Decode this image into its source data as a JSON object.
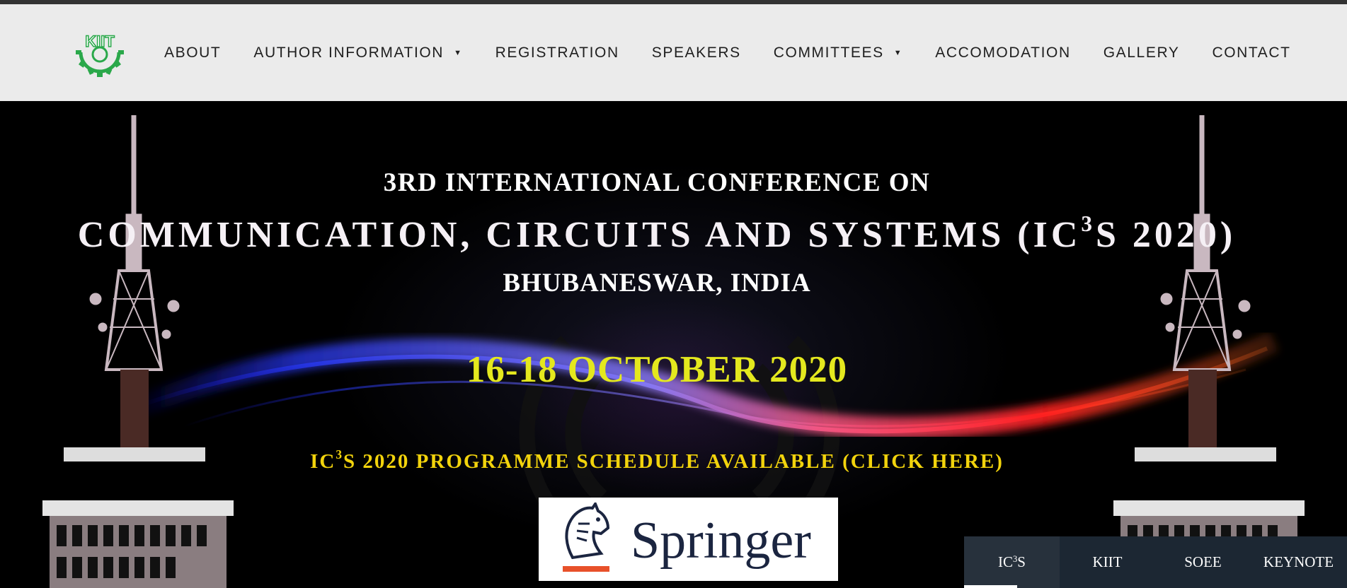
{
  "nav": {
    "logo_icon": "kiit-gear-logo",
    "items": [
      {
        "label": "ABOUT",
        "dropdown": false
      },
      {
        "label": "AUTHOR INFORMATION",
        "dropdown": true
      },
      {
        "label": "REGISTRATION",
        "dropdown": false
      },
      {
        "label": "SPEAKERS",
        "dropdown": false
      },
      {
        "label": "COMMITTEES",
        "dropdown": true
      },
      {
        "label": "ACCOMODATION",
        "dropdown": false
      },
      {
        "label": "GALLERY",
        "dropdown": false
      },
      {
        "label": "CONTACT",
        "dropdown": false
      }
    ],
    "caret_glyph": "▼"
  },
  "hero": {
    "line1": "3RD INTERNATIONAL CONFERENCE ON",
    "line2_prefix": "COMMUNICATION, CIRCUITS AND SYSTEMS (IC",
    "line2_sup": "3",
    "line2_suffix": "S 2020)",
    "line3": "BHUBANESWAR, INDIA",
    "dates": "16-18 OCTOBER 2020",
    "schedule_prefix": "IC",
    "schedule_sup": "3",
    "schedule_suffix": "S 2020 PROGRAMME SCHEDULE AVAILABLE (CLICK HERE)",
    "publisher_logo": "Springer",
    "publisher_icon": "springer-horse-icon"
  },
  "tabs": [
    {
      "prefix": "IC",
      "sup": "3",
      "suffix": "S",
      "active": true
    },
    {
      "prefix": "KIIT",
      "sup": "",
      "suffix": "",
      "active": false
    },
    {
      "prefix": "SOEE",
      "sup": "",
      "suffix": "",
      "active": false
    },
    {
      "prefix": "KEYNOTE",
      "sup": "",
      "suffix": "",
      "active": false
    }
  ],
  "colors": {
    "nav_bg": "#ebebeb",
    "hero_bg": "#000000",
    "title_white": "#ffffff",
    "dates_yellow": "#e4e81e",
    "schedule_yellow": "#f2d30c",
    "logo_green": "#2aa84a",
    "tabs_bg": "#1c2733"
  }
}
